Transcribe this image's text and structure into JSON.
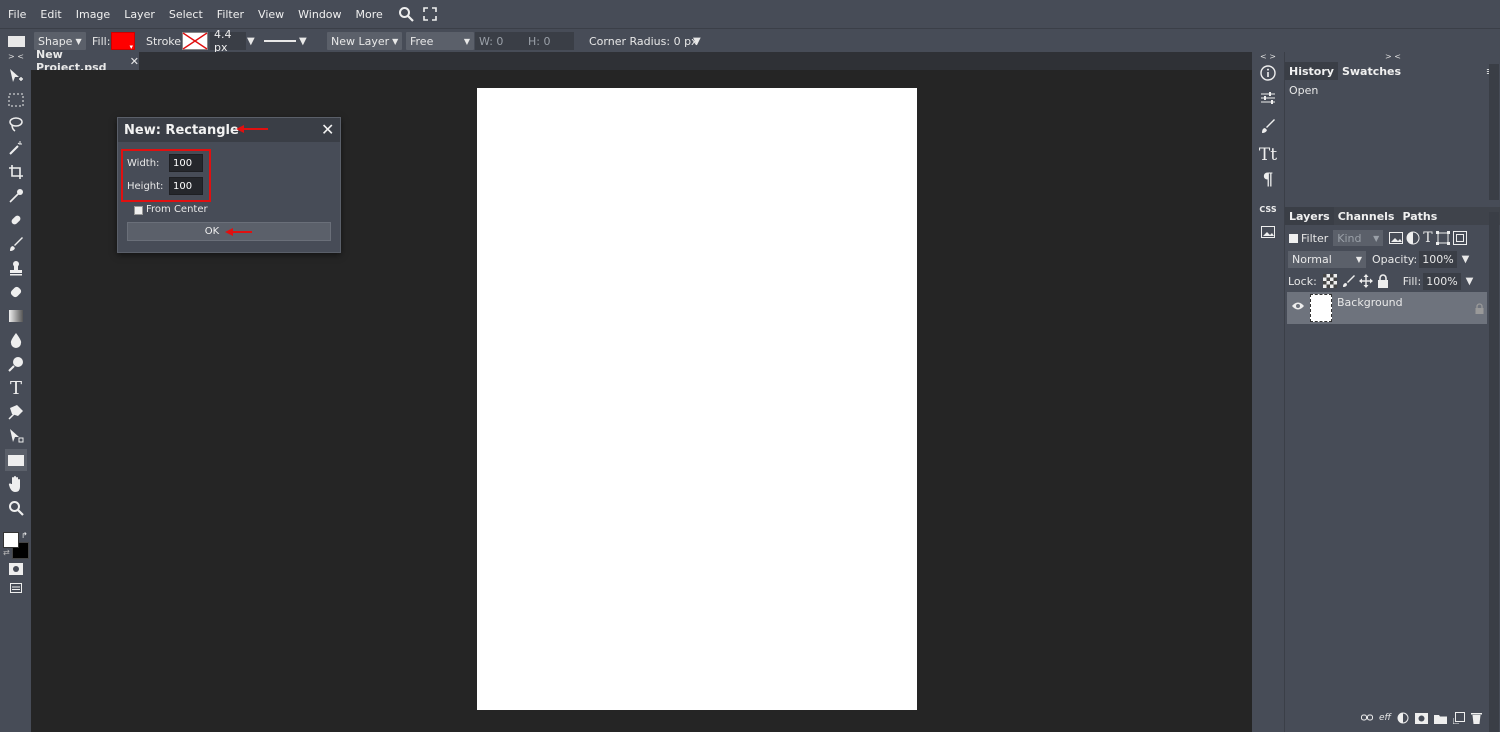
{
  "menu": [
    "File",
    "Edit",
    "Image",
    "Layer",
    "Select",
    "Filter",
    "View",
    "Window",
    "More"
  ],
  "options": {
    "shape_label": "Shape",
    "fill_label": "Fill:",
    "fill_color": "#ff0000",
    "stroke_label": "Stroke:",
    "stroke_width": "4.4 px",
    "new_layer": "New Layer",
    "mode": "Free",
    "w_label": "W: 0",
    "h_label": "H: 0",
    "corner_radius": "Corner Radius: 0 px"
  },
  "document": {
    "tab_title": "New Project.psd",
    "tab_close": "✕"
  },
  "dialog": {
    "title": "New: Rectangle",
    "close": "✕",
    "width_label": "Width:",
    "width_value": "100",
    "height_label": "Height:",
    "height_value": "100",
    "from_center_label": "From Center",
    "from_center_checked": false,
    "ok_label": "OK"
  },
  "right_strip": {
    "css_label": "CSS"
  },
  "history_panel": {
    "collapse": "> <",
    "tabs": [
      "History",
      "Swatches"
    ],
    "menu_icon": "≡",
    "items": [
      "Open"
    ]
  },
  "layers_panel": {
    "tabs": [
      "Layers",
      "Channels",
      "Paths"
    ],
    "filter_label": "Filter",
    "kind_label": "Kind",
    "blend_mode": "Normal",
    "opacity_label": "Opacity:",
    "opacity_value": "100%",
    "lock_label": "Lock:",
    "fill_label": "Fill:",
    "fill_value": "100%",
    "layers": [
      {
        "name": "Background",
        "visible": true,
        "locked": true
      }
    ],
    "footer_fx": "eff"
  },
  "colors": {
    "accent_red": "#e01010",
    "panel_bg": "#474c57",
    "canvas_bg": "#252525",
    "foreground": "#ffffff",
    "background": "#000000"
  }
}
